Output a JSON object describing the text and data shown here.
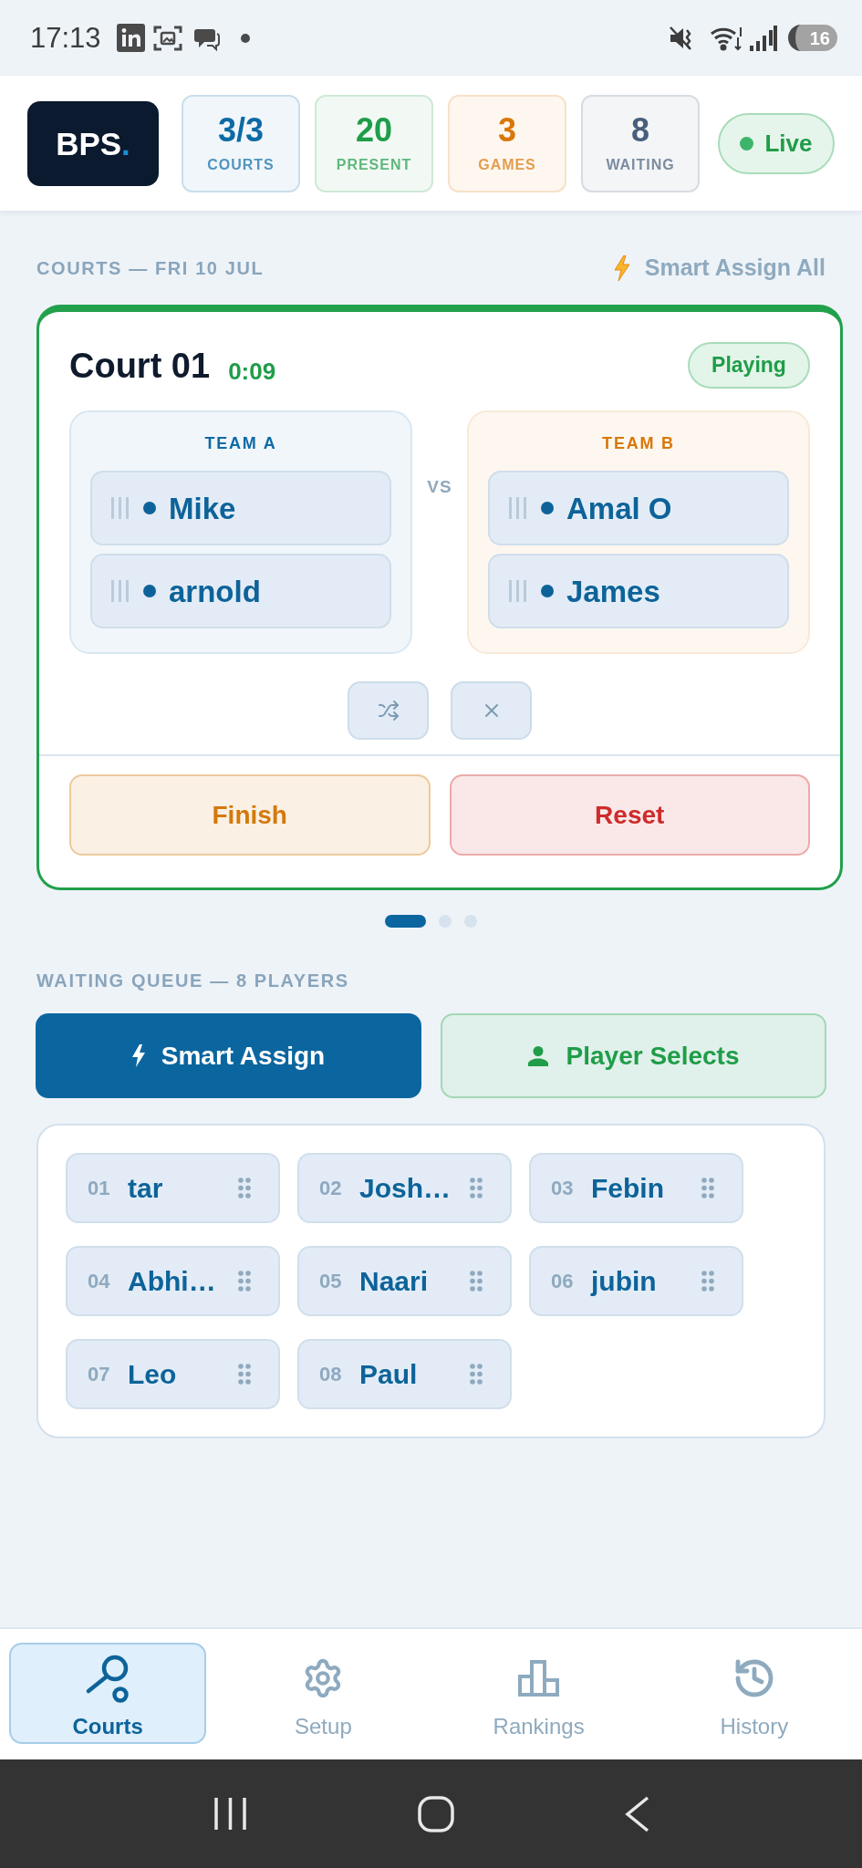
{
  "status_bar": {
    "time": "17:13",
    "battery": "16"
  },
  "header": {
    "logo": {
      "text": "BPS",
      "accent": "."
    },
    "stats": [
      {
        "value": "3/3",
        "label": "COURTS",
        "color": "#0e6aa5"
      },
      {
        "value": "20",
        "label": "PRESENT",
        "color": "#1f9d48"
      },
      {
        "value": "3",
        "label": "GAMES",
        "color": "#d97706"
      },
      {
        "value": "8",
        "label": "WAITING",
        "color": "#475f7b"
      }
    ],
    "live": {
      "label": "Live",
      "on": true
    }
  },
  "courts": {
    "title": "COURTS — FRI 10 JUL",
    "action": "Smart Assign All",
    "court": {
      "name": "Court 01",
      "timer": "0:09",
      "status": "Playing",
      "teams": [
        {
          "label": "TEAM A",
          "color": "#0e6aa5",
          "players": [
            "Mike",
            "arnold"
          ]
        },
        {
          "label": "TEAM B",
          "color": "#d97706",
          "players": [
            "Amal O",
            "James"
          ]
        }
      ],
      "vs": "VS",
      "actions": [
        {
          "label": "Finish",
          "color": "#d4790c"
        },
        {
          "label": "Reset",
          "color": "#cf2b2b"
        }
      ]
    },
    "pager": [
      {
        "selected": true
      },
      {
        "selected": false
      },
      {
        "selected": false
      }
    ]
  },
  "queue": {
    "title": "WAITING QUEUE — 8 PLAYERS",
    "buttons": [
      {
        "label": "Smart Assign",
        "kind": "auto"
      },
      {
        "label": "Player Selects",
        "kind": "manual"
      }
    ],
    "players": [
      {
        "number": "01",
        "name": "tar"
      },
      {
        "number": "02",
        "name": "Josh…"
      },
      {
        "number": "03",
        "name": "Febin"
      },
      {
        "number": "04",
        "name": "Abhi…"
      },
      {
        "number": "05",
        "name": "Naari"
      },
      {
        "number": "06",
        "name": "jubin"
      },
      {
        "number": "07",
        "name": "Leo"
      },
      {
        "number": "08",
        "name": "Paul"
      }
    ]
  },
  "nav": [
    {
      "label": "Courts",
      "selected": true
    },
    {
      "label": "Setup",
      "selected": false
    },
    {
      "label": "Rankings",
      "selected": false
    },
    {
      "label": "History",
      "selected": false
    }
  ]
}
